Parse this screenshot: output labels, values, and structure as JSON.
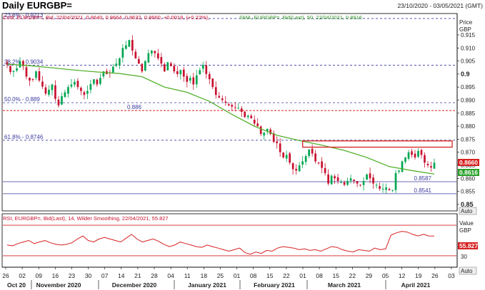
{
  "header": {
    "title": "Daily EURGBP=",
    "date_range": "23/10/2020 - 03/05/2021 (GMT)"
  },
  "price_panel": {
    "legend_cndl": "Cndl, EURGBP=, Bid, 22/04/2021, 0.8640, 0.8664, 0.8632, 0.8660, +0.0019, (+0.22%),",
    "legend_sma": "SMA, EURGBP=, Bid(Last), 50, 22/04/2021, 0.8616",
    "axis_title_1": "Price",
    "axis_title_2": "GBP",
    "auto_label": "Auto",
    "last_price_tag": "0.8660",
    "sma_tag": "0.8616"
  },
  "rsi_panel": {
    "legend": "RSI, EURGBP=, Bid(Last), 14, Wilder Smoothing, 22/04/2021, 55.827",
    "axis_title_1": "Value",
    "axis_title_2": "GBP",
    "rsi_tag": "55.827",
    "level_label": "30",
    "auto_label": "Auto"
  },
  "x_axis": {
    "day_ticks": [
      "26",
      "02",
      "09",
      "16",
      "23",
      "30",
      "07",
      "14",
      "21",
      "28",
      "04",
      "11",
      "18",
      "25",
      "01",
      "08",
      "15",
      "22",
      "01",
      "08",
      "15",
      "22",
      "29",
      "05",
      "12",
      "19",
      "26",
      "03"
    ],
    "month_labels": [
      "Oct 20",
      "November 2020",
      "December 2020",
      "January 2021",
      "February 2021",
      "March 2021",
      "April 2021"
    ]
  },
  "colors": {
    "bull": "#00a651",
    "bear": "#c8102e",
    "sma": "#55b12e",
    "fib": "#3a3aa0",
    "red_line": "#d62020",
    "rsi": "#d62020"
  },
  "chart_data": [
    {
      "type": "candlestick",
      "title": "Daily EURGBP=",
      "y_ticks": [
        0.85,
        0.855,
        0.86,
        0.865,
        0.87,
        0.875,
        0.88,
        0.885,
        0.89,
        0.895,
        0.9,
        0.905,
        0.91,
        0.915,
        0.92
      ],
      "ylim": [
        0.8475,
        0.9232
      ],
      "x": [
        "2020-10-26",
        "2021-04-22"
      ],
      "levels": [
        {
          "label": "23.6% - 0.9213",
          "value": 0.9213
        },
        {
          "label": "38.2% - 0.9034",
          "value": 0.9034
        },
        {
          "label": "50.0% - 0.889",
          "value": 0.889
        },
        {
          "label": "61.8% - 0.8746",
          "value": 0.8746
        },
        {
          "label": "0.8587",
          "value": 0.8587
        },
        {
          "label": "0.8541",
          "value": 0.8541
        }
      ],
      "horizontal_line": {
        "label": "0.886",
        "value": 0.886
      },
      "resistance_box": {
        "from": "2021-02-25",
        "to": "2021-04-22",
        "low": 0.8725,
        "high": 0.8738
      },
      "series": [
        {
          "name": "EURGBP= (daily closes, approx.)",
          "values": [
            0.9035,
            0.9008,
            0.9012,
            0.9022,
            0.905,
            0.903,
            0.899,
            0.8975,
            0.898,
            0.901,
            0.8975,
            0.8952,
            0.8925,
            0.894,
            0.896,
            0.8905,
            0.888,
            0.8915,
            0.893,
            0.895,
            0.896,
            0.897,
            0.895,
            0.8935,
            0.892,
            0.8935,
            0.8962,
            0.898,
            0.896,
            0.8985,
            0.901,
            0.9,
            0.9005,
            0.9028,
            0.904,
            0.906,
            0.91,
            0.911,
            0.913,
            0.909,
            0.906,
            0.904,
            0.901,
            0.905,
            0.908,
            0.909,
            0.908,
            0.906,
            0.904,
            0.901,
            0.9045,
            0.903,
            0.901,
            0.9,
            0.9015,
            0.899,
            0.897,
            0.8985,
            0.896,
            0.8995,
            0.9015,
            0.9035,
            0.9,
            0.898,
            0.895,
            0.892,
            0.891,
            0.89,
            0.889,
            0.888,
            0.8875,
            0.887,
            0.887,
            0.8855,
            0.8835,
            0.884,
            0.883,
            0.881,
            0.88,
            0.877,
            0.8775,
            0.879,
            0.877,
            0.874,
            0.8735,
            0.87,
            0.868,
            0.869,
            0.866,
            0.8635,
            0.863,
            0.865,
            0.8665,
            0.8685,
            0.871,
            0.8695,
            0.8665,
            0.866,
            0.864,
            0.862,
            0.858,
            0.861,
            0.86,
            0.859,
            0.8585,
            0.8575,
            0.859,
            0.86,
            0.859,
            0.858,
            0.8575,
            0.859,
            0.8615,
            0.86,
            0.858,
            0.8575,
            0.856,
            0.856,
            0.8565,
            0.8555,
            0.8555,
            0.862,
            0.863,
            0.8665,
            0.868,
            0.87,
            0.869,
            0.868,
            0.8705,
            0.869,
            0.866,
            0.865,
            0.8641,
            0.866
          ]
        },
        {
          "name": "SMA 50",
          "values": [
            0.9038,
            0.9032,
            0.9024,
            0.9015,
            0.9008,
            0.9002,
            0.899,
            0.895,
            0.893,
            0.8895,
            0.8845,
            0.88,
            0.8765,
            0.8745,
            0.8727,
            0.8707,
            0.868,
            0.8645,
            0.863,
            0.8616
          ]
        }
      ]
    },
    {
      "type": "line",
      "title": "RSI, EURGBP=, Bid(Last), 14, Wilder Smoothing",
      "ylim": [
        15,
        85
      ],
      "levels": [
        70,
        30
      ],
      "series": [
        {
          "name": "RSI 14",
          "values": [
            44,
            43,
            46,
            48,
            50,
            46,
            48,
            50,
            47,
            45,
            44,
            45,
            47,
            52,
            56,
            50,
            48,
            52,
            54,
            52,
            50,
            48,
            53,
            58,
            52,
            48,
            50,
            52,
            49,
            45,
            42,
            44,
            48,
            46,
            44,
            42,
            41,
            44,
            42,
            40,
            38,
            36,
            38,
            40,
            34,
            32,
            35,
            33,
            37,
            36,
            40,
            42,
            41,
            40,
            38,
            39,
            37,
            38,
            36,
            39,
            42,
            41,
            38,
            36,
            35,
            38,
            37,
            36,
            40,
            38,
            39,
            57,
            60,
            62,
            61,
            58,
            56,
            58,
            56,
            55.827
          ]
        }
      ]
    }
  ]
}
